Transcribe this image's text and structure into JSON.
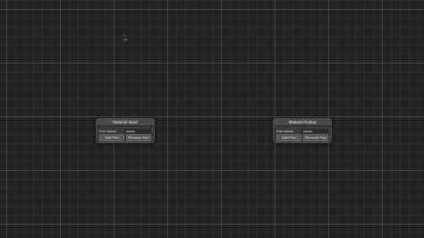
{
  "nodes": [
    {
      "title": "Material Input",
      "port_label": "Port Name",
      "port_value": "name",
      "add_label": "Add Port",
      "remove_label": "Remove Port"
    },
    {
      "title": "Material Output",
      "port_label": "Port Name",
      "port_value": "name",
      "add_label": "Add Port",
      "remove_label": "Remove Port"
    }
  ],
  "colors": {
    "canvas_bg": "#222222",
    "node_bg": "#3a3a3a",
    "node_header": "#4b4b4b"
  },
  "icons": [
    "mouse-cursor-icon"
  ]
}
